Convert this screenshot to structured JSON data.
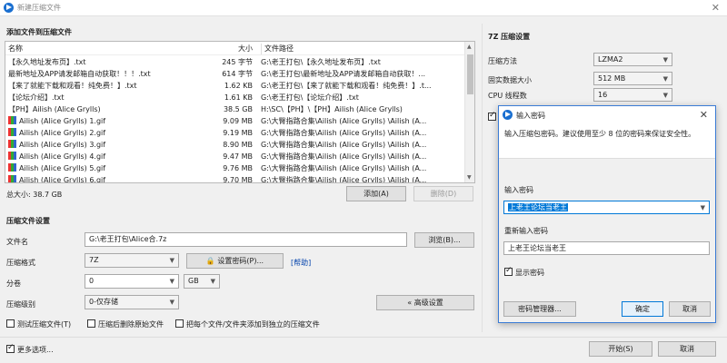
{
  "window": {
    "title": "新建压缩文件",
    "close": "✕"
  },
  "files_section": {
    "title": "添加文件到压缩文件",
    "col_name": "名称",
    "col_size": "大小",
    "col_path": "文件路径",
    "rows": [
      {
        "name": "【永久地址发布页】.txt",
        "size": "245 字节",
        "path": "G:\\老王打包\\【永久地址发布页】.txt",
        "icon": "txt"
      },
      {
        "name": "最新地址及APP请发邮箱自动获取！！！.txt",
        "size": "614 字节",
        "path": "G:\\老王打包\\最新地址及APP请发邮箱自动获取！...",
        "icon": "txt"
      },
      {
        "name": "【来了就能下载和观看！纯免费！】.txt",
        "size": "1.62 KB",
        "path": "G:\\老王打包\\【来了就能下载和观看！纯免费！】.t...",
        "icon": "txt"
      },
      {
        "name": "【论坛介绍】.txt",
        "size": "1.61 KB",
        "path": "G:\\老王打包\\【论坛介绍】.txt",
        "icon": "txt"
      },
      {
        "name": "【PH】Ailish  (Alice Grylls)",
        "size": "38.5 GB",
        "path": "H:\\SC\\【PH】\\【PH】Ailish  (Alice Grylls)",
        "icon": "folder"
      },
      {
        "name": "Ailish  (Alice Grylls)  1.gif",
        "size": "9.09 MB",
        "path": "G:\\大臀指路合集\\Ailish  (Alice Grylls) \\Ailish  (A...",
        "icon": "gif"
      },
      {
        "name": "Ailish  (Alice Grylls)  2.gif",
        "size": "9.19 MB",
        "path": "G:\\大臀指路合集\\Ailish  (Alice Grylls) \\Ailish  (A...",
        "icon": "gif"
      },
      {
        "name": "Ailish  (Alice Grylls)  3.gif",
        "size": "8.90 MB",
        "path": "G:\\大臀指路合集\\Ailish  (Alice Grylls) \\Ailish  (A...",
        "icon": "gif"
      },
      {
        "name": "Ailish  (Alice Grylls)  4.gif",
        "size": "9.47 MB",
        "path": "G:\\大臀指路合集\\Ailish  (Alice Grylls) \\Ailish  (A...",
        "icon": "gif"
      },
      {
        "name": "Ailish  (Alice Grylls)  5.gif",
        "size": "9.76 MB",
        "path": "G:\\大臀指路合集\\Ailish  (Alice Grylls) \\Ailish  (A...",
        "icon": "gif"
      },
      {
        "name": "Ailish  (Alice Grylls)  6.gif",
        "size": "9.70 MB",
        "path": "G:\\大臀指路合集\\Ailish  (Alice Grylls) \\Ailish  (A...",
        "icon": "gif"
      }
    ],
    "total": "总大小: 38.7 GB",
    "add_button": "添加(A)",
    "delete_button": "删除(D)"
  },
  "archive_settings": {
    "title": "压缩文件设置",
    "filename_label": "文件名",
    "filename_value": "G:\\老王打包\\Alice合.7z",
    "browse_button": "浏览(B)...",
    "format_label": "压缩格式",
    "format_value": "7Z",
    "set_password_button": "设置密码(P)...",
    "help_link": "[帮助]",
    "volume_label": "分卷",
    "volume_value": "0",
    "volume_unit": "GB",
    "level_label": "压缩级别",
    "level_value": "0-仅存储",
    "advanced_button": "« 高级设置",
    "opt_test": "测试压缩文件(T)",
    "opt_delete_source": "压缩后删除原始文件",
    "opt_each_separate": "把每个文件/文件夹添加到独立的压缩文件",
    "more_options": "更多选项..."
  },
  "sevenz": {
    "title": "7Z 压缩设置",
    "method_label": "压缩方法",
    "method_value": "LZMA2",
    "solid_label": "固实数据大小",
    "solid_value": "512 MB",
    "threads_label": "CPU 线程数",
    "threads_value": "16"
  },
  "footer": {
    "start_button": "开始(S)",
    "cancel_button": "取消"
  },
  "password_dialog": {
    "title": "输入密码",
    "close": "✕",
    "hint": "输入压缩包密码。建议使用至少 8 位的密码来保证安全性。",
    "pwd_label": "输入密码",
    "pwd_value": "上老王论坛当老王",
    "confirm_label": "重新输入密码",
    "confirm_value": "上老王论坛当老王",
    "show_password": "显示密码",
    "manager_button": "密码管理器...",
    "ok_button": "确定",
    "cancel_button": "取消"
  }
}
